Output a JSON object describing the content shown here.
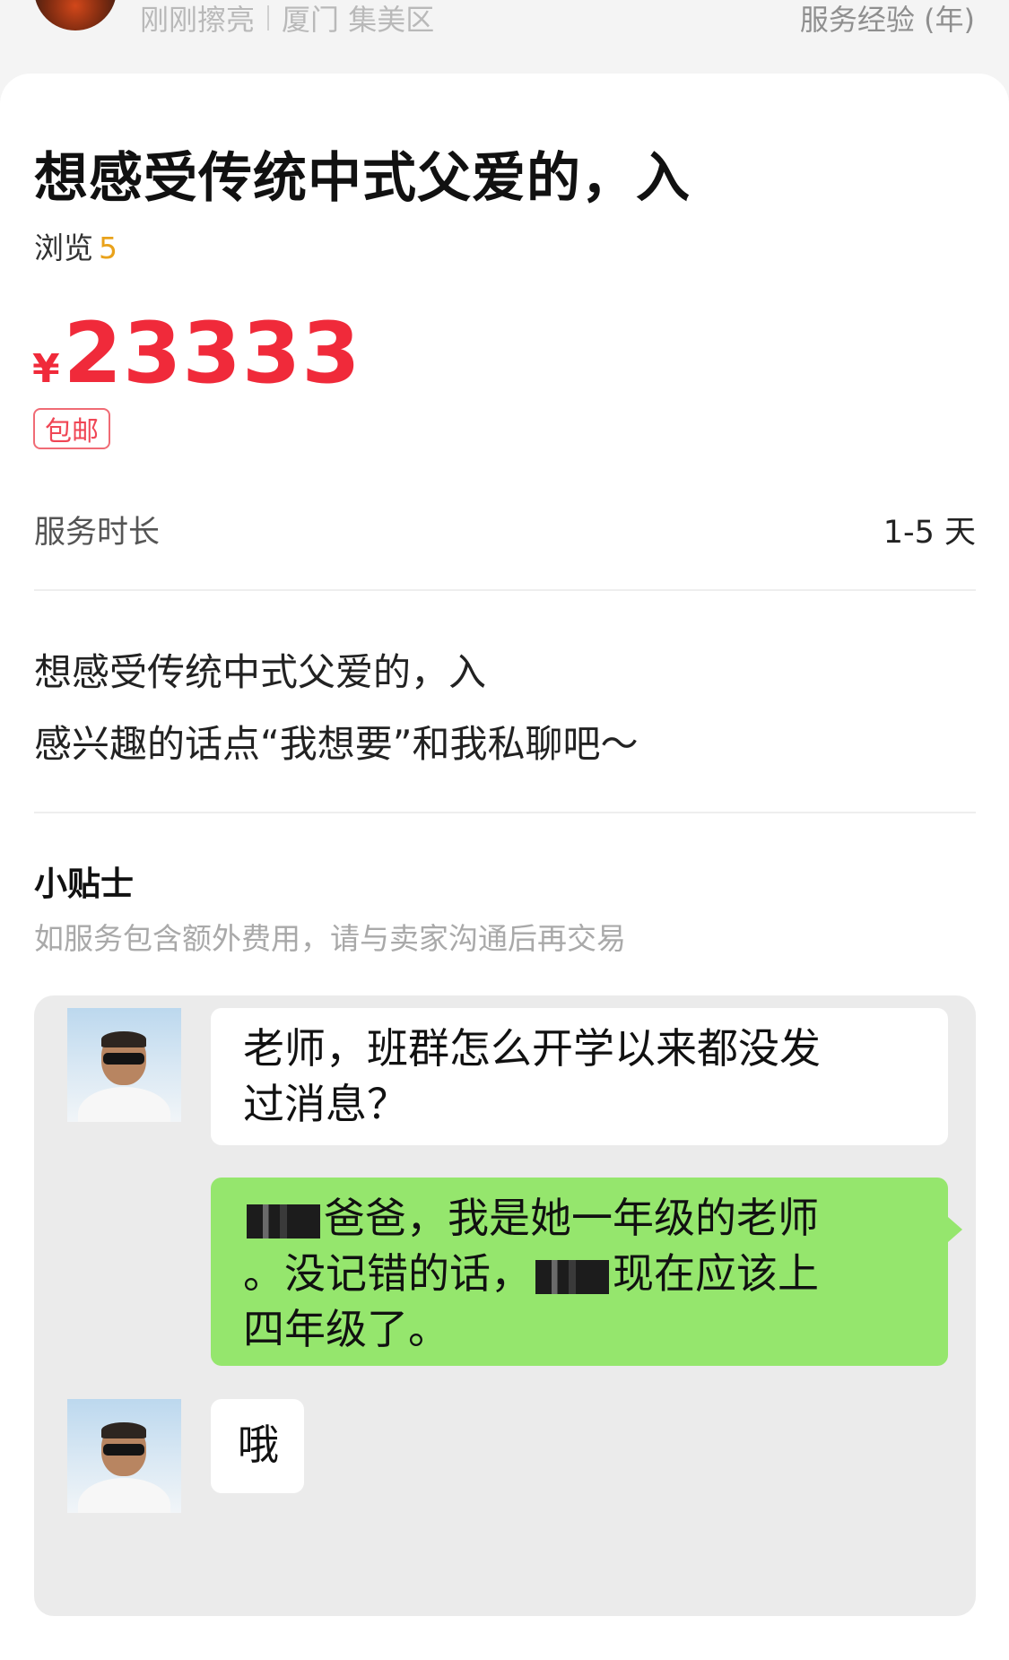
{
  "header": {
    "meta_time": "刚刚擦亮",
    "meta_location": "厦门 集美区",
    "right_label": "服务经验 (年)"
  },
  "listing": {
    "title": "想感受传统中式父爱的，入",
    "views_label": "浏览",
    "views_count": "5",
    "currency": "¥",
    "price": "23333",
    "badge": "包邮",
    "duration_label": "服务时长",
    "duration_value": "1-5 天",
    "description": [
      "想感受传统中式父爱的，入",
      "感兴趣的话点“我想要”和我私聊吧～"
    ]
  },
  "tips": {
    "title": "小贴士",
    "text": "如服务包含额外费用，请与卖家沟通后再交易"
  },
  "chat": {
    "messages": [
      {
        "side": "left",
        "lines": [
          "老师，班群怎么开学以来都没发",
          "过消息？"
        ]
      },
      {
        "side": "right",
        "line1_after": "爸爸，我是她一年级的老师",
        "line2_before": "。没记错的话，",
        "line2_after": "现在应该上",
        "line3": "四年级了。"
      },
      {
        "side": "left",
        "lines": [
          "哦"
        ]
      }
    ]
  },
  "colors": {
    "price_red": "#f02a3a",
    "views_orange": "#e9a21b",
    "chat_bubble_green": "#95e66d"
  }
}
